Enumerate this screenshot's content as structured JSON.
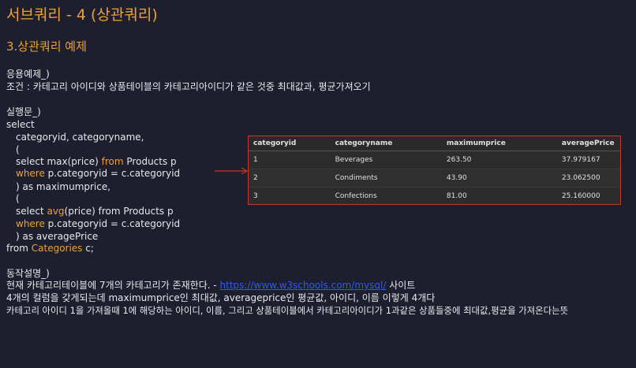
{
  "title": "서브쿼리 - 4 (상관쿼리)",
  "section": "3.상관쿼리 예제",
  "example": {
    "heading": "응용예제_)",
    "condition": "조건 : 카테고리 아이디와 상품테이블의 카테고리아이디가 같은 것중 최대값과, 평균가져오기"
  },
  "code": {
    "heading": "실행문_)",
    "l1": "select",
    "l2": "categoryid, categoryname,",
    "l3": "(",
    "l4a": "select max(price) ",
    "l4b": "from",
    "l4c": " Products p",
    "l5a": "where",
    "l5b": " p.categoryid = c.categoryid",
    "l6": ") as maximumprice,",
    "l7": "(",
    "l8a": "select ",
    "l8b": "avg",
    "l8c": "(price) from Products p",
    "l9a": "where",
    "l9b": " p.categoryid = c.categoryid",
    "l10": ") as averagePrice",
    "l11a": "from ",
    "l11b": "Categories",
    "l11c": " c;"
  },
  "result_table": {
    "columns": [
      "categoryid",
      "categoryname",
      "maximumprice",
      "averagePrice"
    ],
    "rows": [
      [
        "1",
        "Beverages",
        "263.50",
        "37.979167"
      ],
      [
        "2",
        "Condiments",
        "43.90",
        "23.062500"
      ],
      [
        "3",
        "Confections",
        "81.00",
        "25.160000"
      ]
    ]
  },
  "explanation": {
    "heading": "동작설명_)",
    "line1_a": "현재 카테고리테이블에 7개의 카테고리가 존재한다. - ",
    "line1_link": "https://www.w3schools.com/mysql/",
    "line1_b": " 사이트",
    "line2": "4개의 컬럼을 갖게되는데 maximumprice인 최대값, averageprice인 평균값, 아이디, 이름 이렇게 4개다",
    "line3": "카테고리 아이디 1을 가져올때 1에 해당하는 아이디, 이름, 그리고 상품테이블에서 카테고리아이디가 1과같은 상품들중에 최대값,평균을 가져온다는뜻"
  },
  "colors": {
    "accent": "#f0a030",
    "link": "#2a57ff",
    "arrow": "#c0392b",
    "background": "#1e1f2e"
  }
}
